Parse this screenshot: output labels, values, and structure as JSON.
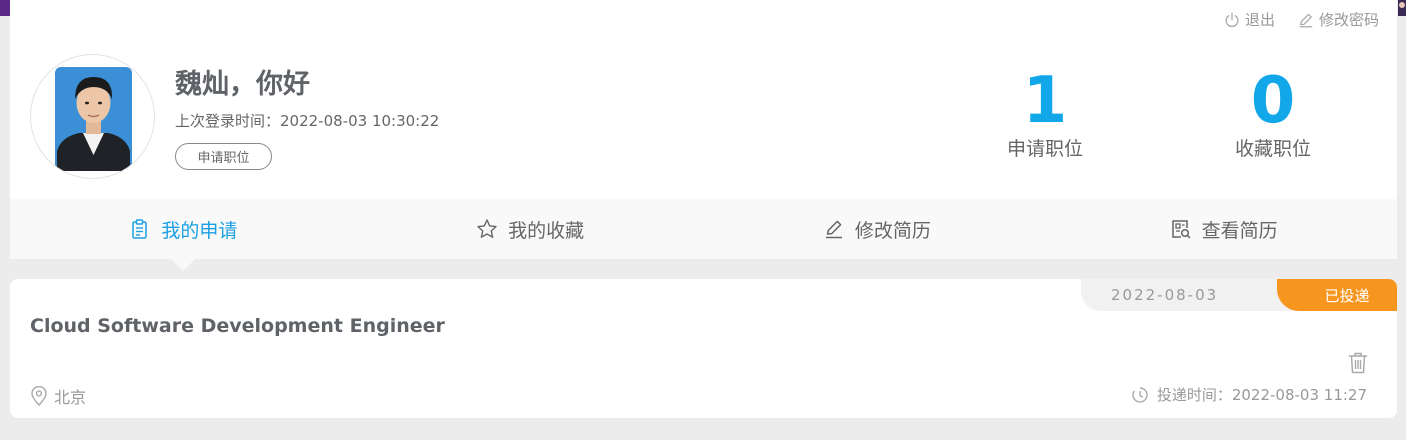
{
  "header": {
    "logout_label": "退出",
    "change_password_label": "修改密码"
  },
  "profile": {
    "greeting": "魏灿，你好",
    "last_login": "上次登录时间：2022-08-03 10:30:22",
    "badge": "申请职位"
  },
  "stats": {
    "applied": {
      "value": "1",
      "label": "申请职位"
    },
    "favorites": {
      "value": "0",
      "label": "收藏职位"
    }
  },
  "tabs": [
    {
      "label": "我的申请",
      "icon": "clipboard-icon",
      "active": true
    },
    {
      "label": "我的收藏",
      "icon": "star-icon",
      "active": false
    },
    {
      "label": "修改简历",
      "icon": "edit-icon",
      "active": false
    },
    {
      "label": "查看简历",
      "icon": "resume-view-icon",
      "active": false
    }
  ],
  "job": {
    "date": "2022-08-03",
    "status": "已投递",
    "title": "Cloud Software Development Engineer",
    "location": "北京",
    "sent_time": "投递时间：2022-08-03 11:27"
  },
  "colors": {
    "accent": "#12a7e8",
    "status": "#f7961f",
    "page_background": "#ececec"
  }
}
